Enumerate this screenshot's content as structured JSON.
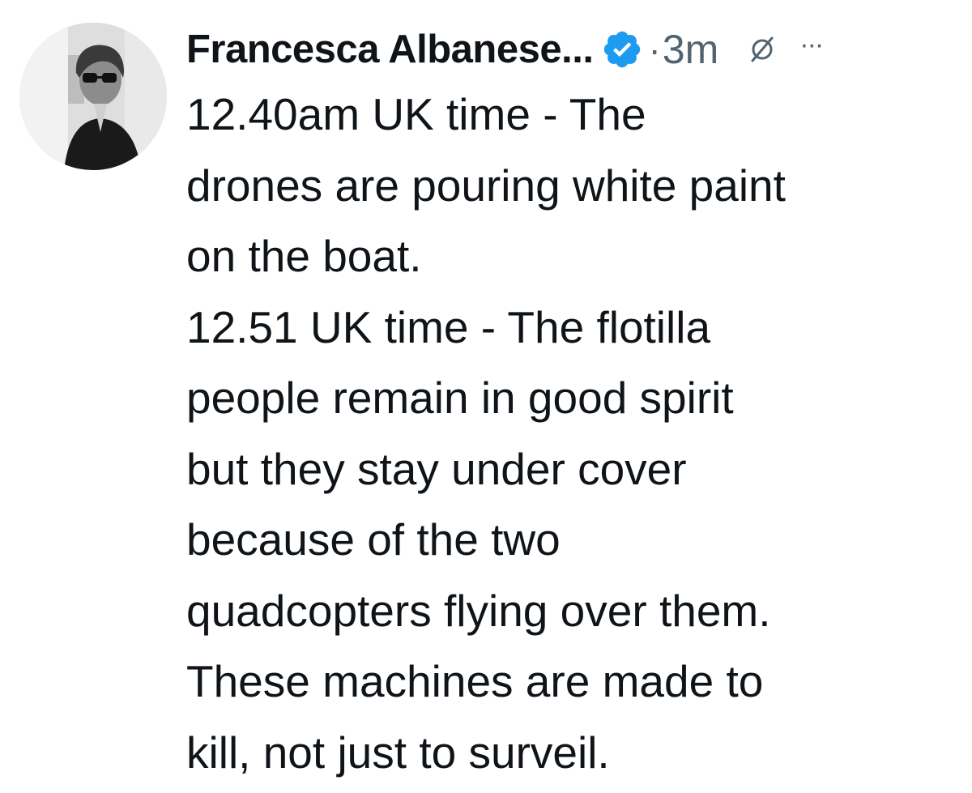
{
  "tweet": {
    "author_name": "Francesca Albanese...",
    "verified": true,
    "separator": "·",
    "timestamp": "3m",
    "more_label": "···",
    "body_lines": [
      "12.40am UK time - The",
      "drones are pouring white paint",
      "on the boat.",
      "12.51 UK time - The flotilla",
      "people remain in good spirit",
      "but they stay under cover",
      "because of the two",
      "quadcopters flying over them.",
      "These machines are made to",
      "kill, not just to surveil."
    ]
  },
  "colors": {
    "text_primary": "#0f1419",
    "text_secondary": "#536471",
    "verified_blue": "#1d9bf0",
    "background": "#ffffff"
  },
  "icons": {
    "verified": "verified-badge-icon",
    "grok": "grok-icon",
    "more": "more-icon"
  }
}
